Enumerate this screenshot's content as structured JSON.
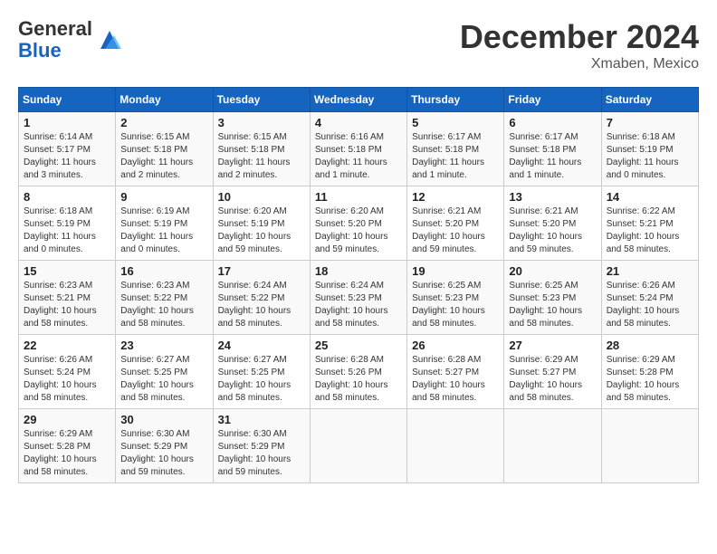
{
  "header": {
    "logo_general": "General",
    "logo_blue": "Blue",
    "month_title": "December 2024",
    "location": "Xmaben, Mexico"
  },
  "days_of_week": [
    "Sunday",
    "Monday",
    "Tuesday",
    "Wednesday",
    "Thursday",
    "Friday",
    "Saturday"
  ],
  "weeks": [
    [
      {
        "day": "1",
        "sunrise": "6:14 AM",
        "sunset": "5:17 PM",
        "daylight": "11 hours and 3 minutes."
      },
      {
        "day": "2",
        "sunrise": "6:15 AM",
        "sunset": "5:18 PM",
        "daylight": "11 hours and 2 minutes."
      },
      {
        "day": "3",
        "sunrise": "6:15 AM",
        "sunset": "5:18 PM",
        "daylight": "11 hours and 2 minutes."
      },
      {
        "day": "4",
        "sunrise": "6:16 AM",
        "sunset": "5:18 PM",
        "daylight": "11 hours and 1 minute."
      },
      {
        "day": "5",
        "sunrise": "6:17 AM",
        "sunset": "5:18 PM",
        "daylight": "11 hours and 1 minute."
      },
      {
        "day": "6",
        "sunrise": "6:17 AM",
        "sunset": "5:18 PM",
        "daylight": "11 hours and 1 minute."
      },
      {
        "day": "7",
        "sunrise": "6:18 AM",
        "sunset": "5:19 PM",
        "daylight": "11 hours and 0 minutes."
      }
    ],
    [
      {
        "day": "8",
        "sunrise": "6:18 AM",
        "sunset": "5:19 PM",
        "daylight": "11 hours and 0 minutes."
      },
      {
        "day": "9",
        "sunrise": "6:19 AM",
        "sunset": "5:19 PM",
        "daylight": "11 hours and 0 minutes."
      },
      {
        "day": "10",
        "sunrise": "6:20 AM",
        "sunset": "5:19 PM",
        "daylight": "10 hours and 59 minutes."
      },
      {
        "day": "11",
        "sunrise": "6:20 AM",
        "sunset": "5:20 PM",
        "daylight": "10 hours and 59 minutes."
      },
      {
        "day": "12",
        "sunrise": "6:21 AM",
        "sunset": "5:20 PM",
        "daylight": "10 hours and 59 minutes."
      },
      {
        "day": "13",
        "sunrise": "6:21 AM",
        "sunset": "5:20 PM",
        "daylight": "10 hours and 59 minutes."
      },
      {
        "day": "14",
        "sunrise": "6:22 AM",
        "sunset": "5:21 PM",
        "daylight": "10 hours and 58 minutes."
      }
    ],
    [
      {
        "day": "15",
        "sunrise": "6:23 AM",
        "sunset": "5:21 PM",
        "daylight": "10 hours and 58 minutes."
      },
      {
        "day": "16",
        "sunrise": "6:23 AM",
        "sunset": "5:22 PM",
        "daylight": "10 hours and 58 minutes."
      },
      {
        "day": "17",
        "sunrise": "6:24 AM",
        "sunset": "5:22 PM",
        "daylight": "10 hours and 58 minutes."
      },
      {
        "day": "18",
        "sunrise": "6:24 AM",
        "sunset": "5:23 PM",
        "daylight": "10 hours and 58 minutes."
      },
      {
        "day": "19",
        "sunrise": "6:25 AM",
        "sunset": "5:23 PM",
        "daylight": "10 hours and 58 minutes."
      },
      {
        "day": "20",
        "sunrise": "6:25 AM",
        "sunset": "5:23 PM",
        "daylight": "10 hours and 58 minutes."
      },
      {
        "day": "21",
        "sunrise": "6:26 AM",
        "sunset": "5:24 PM",
        "daylight": "10 hours and 58 minutes."
      }
    ],
    [
      {
        "day": "22",
        "sunrise": "6:26 AM",
        "sunset": "5:24 PM",
        "daylight": "10 hours and 58 minutes."
      },
      {
        "day": "23",
        "sunrise": "6:27 AM",
        "sunset": "5:25 PM",
        "daylight": "10 hours and 58 minutes."
      },
      {
        "day": "24",
        "sunrise": "6:27 AM",
        "sunset": "5:25 PM",
        "daylight": "10 hours and 58 minutes."
      },
      {
        "day": "25",
        "sunrise": "6:28 AM",
        "sunset": "5:26 PM",
        "daylight": "10 hours and 58 minutes."
      },
      {
        "day": "26",
        "sunrise": "6:28 AM",
        "sunset": "5:27 PM",
        "daylight": "10 hours and 58 minutes."
      },
      {
        "day": "27",
        "sunrise": "6:29 AM",
        "sunset": "5:27 PM",
        "daylight": "10 hours and 58 minutes."
      },
      {
        "day": "28",
        "sunrise": "6:29 AM",
        "sunset": "5:28 PM",
        "daylight": "10 hours and 58 minutes."
      }
    ],
    [
      {
        "day": "29",
        "sunrise": "6:29 AM",
        "sunset": "5:28 PM",
        "daylight": "10 hours and 58 minutes."
      },
      {
        "day": "30",
        "sunrise": "6:30 AM",
        "sunset": "5:29 PM",
        "daylight": "10 hours and 59 minutes."
      },
      {
        "day": "31",
        "sunrise": "6:30 AM",
        "sunset": "5:29 PM",
        "daylight": "10 hours and 59 minutes."
      },
      null,
      null,
      null,
      null
    ]
  ]
}
